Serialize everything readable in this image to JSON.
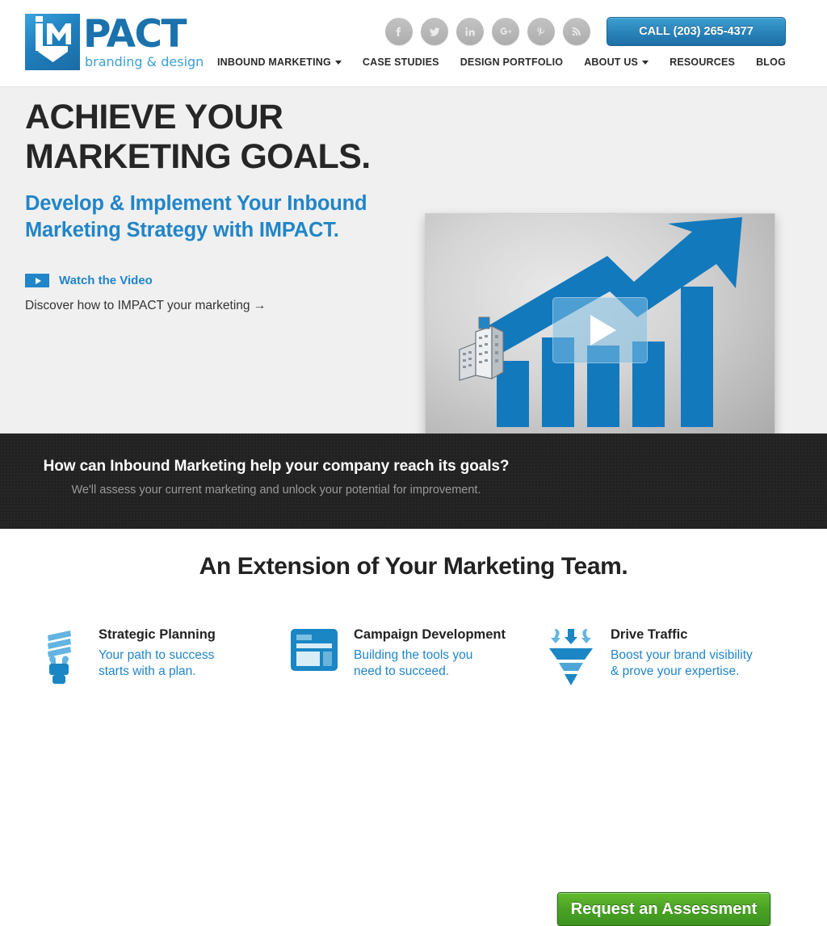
{
  "header": {
    "logo": {
      "mark_text": "iM",
      "word": "PACT",
      "tagline": "branding & design"
    },
    "social": [
      {
        "name": "facebook-icon",
        "label": "f"
      },
      {
        "name": "twitter-icon",
        "label": "t"
      },
      {
        "name": "linkedin-icon",
        "label": "in"
      },
      {
        "name": "googleplus-icon",
        "label": "g+"
      },
      {
        "name": "pinterest-icon",
        "label": "p"
      },
      {
        "name": "rss-icon",
        "label": "rss"
      }
    ],
    "call_button": "CALL (203) 265-4377",
    "nav": [
      {
        "label": "INBOUND MARKETING",
        "has_caret": true
      },
      {
        "label": "CASE STUDIES",
        "has_caret": false
      },
      {
        "label": "DESIGN PORTFOLIO",
        "has_caret": false
      },
      {
        "label": "ABOUT US",
        "has_caret": true
      },
      {
        "label": "RESOURCES",
        "has_caret": false
      },
      {
        "label": "BLOG",
        "has_caret": false
      }
    ]
  },
  "hero": {
    "heading_line1": "ACHIEVE YOUR",
    "heading_line2": "MARKETING GOALS.",
    "subheading_line1": "Develop & Implement Your Inbound",
    "subheading_line2": "Marketing Strategy with IMPACT.",
    "watch_label": "Watch the Video",
    "discover_text": "Discover how to IMPACT your marketing →",
    "video": {
      "alt": "growth bar chart with rising arrow and city buildings",
      "play_overlay": "play-button"
    }
  },
  "cta": {
    "heading": "How can Inbound Marketing help your company reach its goals?",
    "subtext": "We'll assess your current marketing and unlock your potential for improvement.",
    "button_label": "Request an Assessment"
  },
  "features": {
    "title": "An Extension of Your Marketing Team.",
    "items": [
      {
        "icon": "lightbulb-icon",
        "title": "Strategic Planning",
        "desc_line1": "Your path to success",
        "desc_line2": "starts with a plan."
      },
      {
        "icon": "browser-layout-icon",
        "title": "Campaign Development",
        "desc_line1": "Building the tools you",
        "desc_line2": "need to succeed."
      },
      {
        "icon": "funnel-icon",
        "title": "Drive Traffic",
        "desc_line1": "Boost your brand visibility",
        "desc_line2": "& prove your expertise."
      }
    ]
  },
  "colors": {
    "brand_blue": "#2185c8",
    "logo_blue": "#1b72ad",
    "cta_dark": "#222222",
    "green": "#4aa324",
    "hero_bg": "#f0f0f0"
  }
}
